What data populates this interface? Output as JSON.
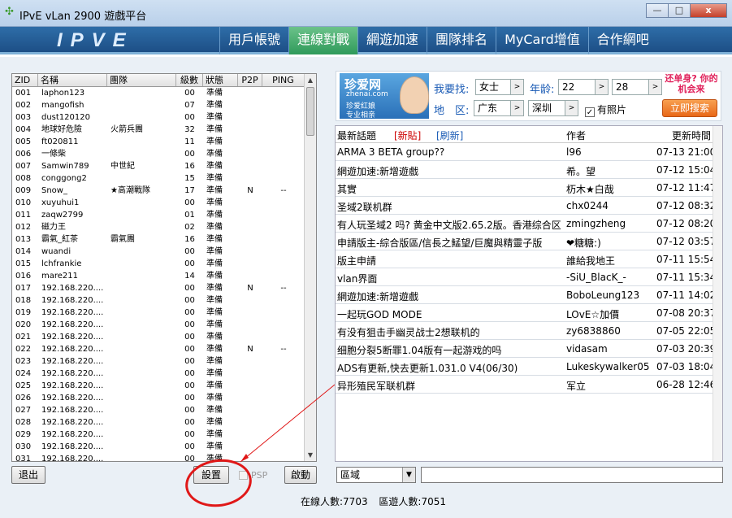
{
  "window": {
    "title": "IPvE vLan 2900 遊戲平台",
    "minimize": "—",
    "maximize": "□",
    "close": "x"
  },
  "nav": {
    "logo": "IPVE",
    "tabs": [
      "用戶帳號",
      "連線對戰",
      "網遊加速",
      "團隊排名",
      "MyCard增值",
      "合作網吧"
    ],
    "active_index": 1
  },
  "players": {
    "headers": [
      "ZID",
      "名稱",
      "團隊",
      "級數",
      "狀態",
      "P2P",
      "PING"
    ],
    "rows": [
      [
        "001",
        "laphon123",
        "",
        "00",
        "準備",
        "",
        ""
      ],
      [
        "002",
        "mangofish",
        "",
        "07",
        "準備",
        "",
        ""
      ],
      [
        "003",
        "dust120120",
        "",
        "00",
        "準備",
        "",
        ""
      ],
      [
        "004",
        "地球好危險",
        "火箭兵團",
        "32",
        "準備",
        "",
        ""
      ],
      [
        "005",
        "ft020811",
        "",
        "11",
        "準備",
        "",
        ""
      ],
      [
        "006",
        "一條柴",
        "",
        "00",
        "準備",
        "",
        ""
      ],
      [
        "007",
        "Samwin789",
        "中世紀",
        "16",
        "準備",
        "",
        ""
      ],
      [
        "008",
        "conggong2",
        "",
        "15",
        "準備",
        "",
        ""
      ],
      [
        "009",
        "Snow_",
        "★高潮戰隊",
        "17",
        "準備",
        "N",
        "--"
      ],
      [
        "010",
        "xuyuhui1",
        "",
        "00",
        "準備",
        "",
        ""
      ],
      [
        "011",
        "zaqw2799",
        "",
        "01",
        "準備",
        "",
        ""
      ],
      [
        "012",
        "磁力王",
        "",
        "02",
        "準備",
        "",
        ""
      ],
      [
        "013",
        "霸氣_紅茶",
        "霸氣團",
        "16",
        "準備",
        "",
        ""
      ],
      [
        "014",
        "wuandi",
        "",
        "00",
        "準備",
        "",
        ""
      ],
      [
        "015",
        "lchfrankie",
        "",
        "00",
        "準備",
        "",
        ""
      ],
      [
        "016",
        "mare211",
        "",
        "14",
        "準備",
        "",
        ""
      ],
      [
        "017",
        "192.168.220....",
        "",
        "00",
        "準備",
        "N",
        "--"
      ],
      [
        "018",
        "192.168.220....",
        "",
        "00",
        "準備",
        "",
        ""
      ],
      [
        "019",
        "192.168.220....",
        "",
        "00",
        "準備",
        "",
        ""
      ],
      [
        "020",
        "192.168.220....",
        "",
        "00",
        "準備",
        "",
        ""
      ],
      [
        "021",
        "192.168.220....",
        "",
        "00",
        "準備",
        "",
        ""
      ],
      [
        "022",
        "192.168.220....",
        "",
        "00",
        "準備",
        "N",
        "--"
      ],
      [
        "023",
        "192.168.220....",
        "",
        "00",
        "準備",
        "",
        ""
      ],
      [
        "024",
        "192.168.220....",
        "",
        "00",
        "準備",
        "",
        ""
      ],
      [
        "025",
        "192.168.220....",
        "",
        "00",
        "準備",
        "",
        ""
      ],
      [
        "026",
        "192.168.220....",
        "",
        "00",
        "準備",
        "",
        ""
      ],
      [
        "027",
        "192.168.220....",
        "",
        "00",
        "準備",
        "",
        ""
      ],
      [
        "028",
        "192.168.220....",
        "",
        "00",
        "準備",
        "",
        ""
      ],
      [
        "029",
        "192.168.220....",
        "",
        "00",
        "準備",
        "",
        ""
      ],
      [
        "030",
        "192.168.220....",
        "",
        "00",
        "準備",
        "",
        ""
      ],
      [
        "031",
        "192.168.220....",
        "",
        "00",
        "準備",
        "",
        ""
      ]
    ]
  },
  "buttons": {
    "exit": "退出",
    "settings": "設置",
    "psp": "PSP",
    "start": "啟動"
  },
  "status": {
    "online": "在線人數:7703",
    "playing": "區遊人數:7051"
  },
  "ad": {
    "logo": "珍爱网",
    "logo_sub": "zhenai.com",
    "logo_line1": "珍爱红娘",
    "logo_line2": "专业相亲",
    "find_label": "我要找:",
    "gender": "女士",
    "age_label": "年龄:",
    "age_from": "22",
    "age_to": "28",
    "area_label": "地　区:",
    "province": "广东",
    "city": "深圳",
    "photo_label": "有照片",
    "photo_checked": "✓",
    "badge": "还单身? 你的机会来",
    "search_button": "立即搜索"
  },
  "topics": {
    "header": {
      "latest": "最新話題",
      "new_post": "[新貼]",
      "refresh": "[刷新]",
      "author": "作者",
      "updated": "更新時間"
    },
    "rows": [
      [
        "ARMA 3 BETA group??",
        "l96",
        "07-13 21:00"
      ],
      [
        "網遊加速:新增遊戲",
        "希。望",
        "07-12 15:04"
      ],
      [
        "其實",
        "杤木★白哉",
        "07-12 11:47"
      ],
      [
        "圣域2联机群",
        "chx0244",
        "07-12 08:32"
      ],
      [
        "有人玩圣域2 吗? 黄金中文版2.65.2版。香港综合区",
        "zmingzheng",
        "07-12 08:20"
      ],
      [
        "申請版主-綜合版區/信長之鯭望/巨魔與精靈子版",
        "❤糖糖:)",
        "07-12 03:57"
      ],
      [
        "版主申請",
        "誰給我地王",
        "07-11 15:54"
      ],
      [
        "vlan界面",
        "-SiU_BlacK_-",
        "07-11 15:34"
      ],
      [
        "網遊加速:新增遊戲",
        "BoboLeung123",
        "07-11 14:02"
      ],
      [
        "一起玩GOD MODE",
        "LOvE☆加價",
        "07-08 20:37"
      ],
      [
        "有没有狙击手幽灵战士2想联机的",
        "zy6838860",
        "07-05 22:05"
      ],
      [
        "细胞分裂5断罪1.04版有一起游戏的吗",
        "vidasam",
        "07-03 20:39"
      ],
      [
        "ADS有更新,快去更新1.031.0 V4(06/30)",
        "Lukeskywalker05",
        "07-03 18:04"
      ],
      [
        "异形殖民军联机群",
        "军立",
        "06-28 12:46"
      ]
    ]
  },
  "region_select": "區域",
  "icons": {
    "app": "game-controller-icon",
    "dropdown": "chevron-down-icon",
    "scroll_up": "arrow-up-icon",
    "scroll_down": "arrow-down-icon"
  },
  "colors": {
    "nav_bg": "#1d4f86",
    "active_tab": "#2f9a5a",
    "annotation": "#e01818",
    "new_post": "#cc0000",
    "refresh": "#1a5bb5"
  }
}
